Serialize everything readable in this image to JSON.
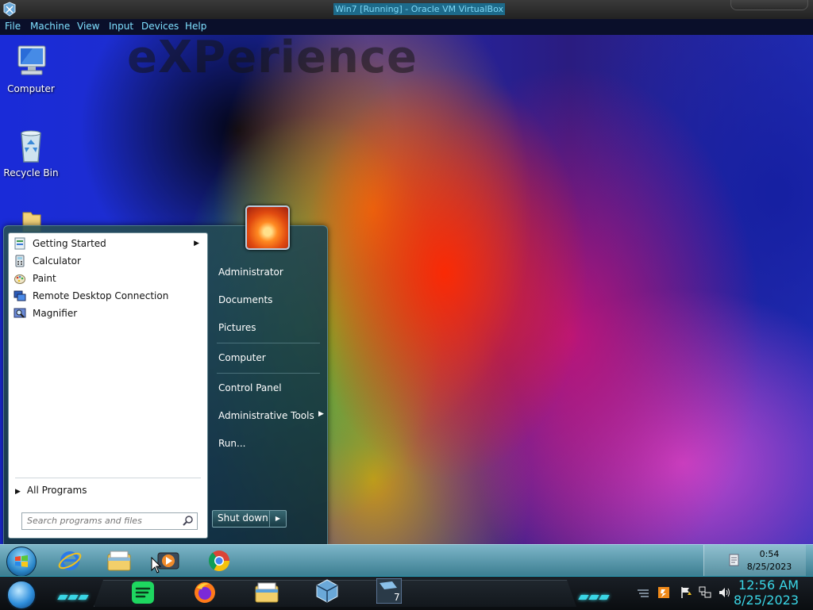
{
  "host_window": {
    "title": "Win7 [Running] - Oracle VM VirtualBox",
    "menu": [
      "File",
      "Machine",
      "View",
      "Input",
      "Devices",
      "Help"
    ]
  },
  "desktop": {
    "watermark": "eXPerience",
    "icons": [
      {
        "label": "Computer",
        "icon": "computer-icon"
      },
      {
        "label": "Recycle Bin",
        "icon": "recycle-bin-icon"
      },
      {
        "label": "",
        "icon": "folder-icon"
      }
    ]
  },
  "start_menu": {
    "programs": [
      {
        "label": "Getting Started",
        "icon": "getting-started-icon",
        "has_submenu": true
      },
      {
        "label": "Calculator",
        "icon": "calculator-icon",
        "has_submenu": false
      },
      {
        "label": "Paint",
        "icon": "paint-icon",
        "has_submenu": false
      },
      {
        "label": "Remote Desktop Connection",
        "icon": "remote-desktop-icon",
        "has_submenu": false
      },
      {
        "label": "Magnifier",
        "icon": "magnifier-icon",
        "has_submenu": false
      }
    ],
    "all_programs_label": "All Programs",
    "search_placeholder": "Search programs and files",
    "places": [
      {
        "label": "Administrator"
      },
      {
        "label": "Documents"
      },
      {
        "label": "Pictures"
      },
      {
        "label": "Computer"
      },
      {
        "label": "Control Panel"
      },
      {
        "label": "Administrative Tools",
        "has_submenu": true
      },
      {
        "label": "Run..."
      }
    ],
    "shutdown_label": "Shut down"
  },
  "guest_taskbar": {
    "pinned": [
      "internet-explorer-icon",
      "windows-explorer-icon",
      "media-player-icon",
      "chrome-icon"
    ],
    "clock_time": "0:54",
    "clock_date": "8/25/2023"
  },
  "host_taskbar": {
    "apps": [
      "spotify-icon",
      "firefox-icon",
      "file-explorer-icon",
      "virtualbox-icon",
      "win7-vm-icon"
    ],
    "clock_time": "12:56 AM",
    "clock_date": "8/25/2023",
    "colors": {
      "accent": "#3ad6e6"
    }
  }
}
